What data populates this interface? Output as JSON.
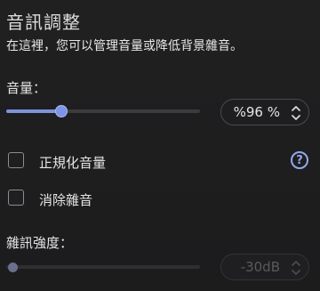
{
  "title": "音訊調整",
  "description": "在這裡，您可以管理音量或降低背景雜音。",
  "volume": {
    "label": "音量：",
    "value_text": "%96 %",
    "level": 0.96
  },
  "normalize": {
    "label": "正規化音量",
    "checked": false,
    "help_icon": "question-circle-icon",
    "help_glyph": "?"
  },
  "noise_removal": {
    "label": "消除雜音",
    "checked": false
  },
  "noise_strength": {
    "label": "雜訊強度：",
    "value_text": "-30dB",
    "level": 0.0,
    "disabled": true
  },
  "colors": {
    "accent": "#7c95e4",
    "background": "#1d1d1f"
  }
}
